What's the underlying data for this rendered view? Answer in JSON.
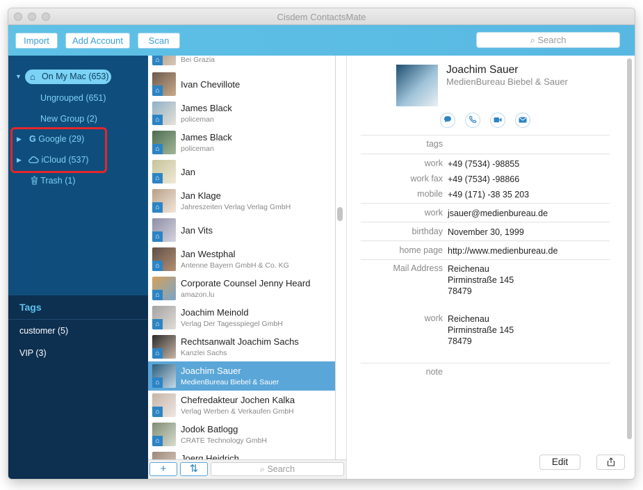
{
  "window": {
    "title": "Cisdem ContactsMate"
  },
  "toolbar": {
    "import_label": "Import",
    "add_account_label": "Add Account",
    "scan_label": "Scan",
    "search_placeholder": "Search"
  },
  "sidebar": {
    "on_my_mac": "On My Mac (653)",
    "ungrouped": "Ungrouped (651)",
    "new_group": "New Group (2)",
    "google": "Google (29)",
    "icloud": "iCloud (537)",
    "trash": "Trash (1)",
    "tags_title": "Tags",
    "tags": [
      "customer (5)",
      "VIP (3)"
    ]
  },
  "contacts": [
    {
      "name": "",
      "subtitle": "Bei Grazia",
      "selected": false
    },
    {
      "name": "Ivan Chevillote",
      "subtitle": "",
      "selected": false
    },
    {
      "name": "James Black",
      "subtitle": "policeman",
      "selected": false
    },
    {
      "name": "James Black",
      "subtitle": "policeman",
      "selected": false
    },
    {
      "name": "Jan",
      "subtitle": "",
      "selected": false
    },
    {
      "name": "Jan Klage",
      "subtitle": "Jahreszeiten Verlag Verlag GmbH",
      "selected": false
    },
    {
      "name": "Jan Vits",
      "subtitle": "",
      "selected": false
    },
    {
      "name": "Jan Westphal",
      "subtitle": "Antenne Bayern GmbH & Co. KG",
      "selected": false
    },
    {
      "name": "Corporate Counsel Jenny Heard",
      "subtitle": "amazon.lu",
      "selected": false
    },
    {
      "name": "Joachim Meinold",
      "subtitle": "Verlag Der Tagesspiegel GmbH",
      "selected": false
    },
    {
      "name": "Rechtsanwalt Joachim Sachs",
      "subtitle": "Kanzlei Sachs",
      "selected": false
    },
    {
      "name": "Joachim Sauer",
      "subtitle": "MedienBureau Biebel & Sauer",
      "selected": true
    },
    {
      "name": "Chefredakteur Jochen Kalka",
      "subtitle": "Verlag Werben & Verkaufen GmbH",
      "selected": false
    },
    {
      "name": "Jodok Batlogg",
      "subtitle": "CRATE Technology GmbH",
      "selected": false
    },
    {
      "name": "Joerg Heidrich",
      "subtitle": "",
      "selected": false
    }
  ],
  "list_footer": {
    "add_label": "+",
    "sort_label": "⇅",
    "search_placeholder": "Search"
  },
  "detail": {
    "name": "Joachim Sauer",
    "company": "MedienBureau Biebel & Sauer",
    "actions": [
      "message-icon",
      "phone-icon",
      "video-icon",
      "mail-icon"
    ],
    "tags_label": "tags",
    "phones": [
      {
        "label": "work",
        "value": "+49 (7534) -98855"
      },
      {
        "label": "work fax",
        "value": "+49 (7534) -98866"
      },
      {
        "label": "mobile",
        "value": "+49 (171) -38 35 203"
      }
    ],
    "email": {
      "label": "work",
      "value": "jsauer@medienbureau.de"
    },
    "birthday": {
      "label": "birthday",
      "value": "November 30, 1999"
    },
    "homepage": {
      "label": "home page",
      "value": "http://www.medienbureau.de"
    },
    "addresses": [
      {
        "label": "Mail Address",
        "line1": "Reichenau",
        "line2": "Pirminstraße 145",
        "line3": "78479"
      },
      {
        "label": "work",
        "line1": "Reichenau",
        "line2": "Pirminstraße 145",
        "line3": "78479"
      }
    ],
    "note_label": "note",
    "edit_label": "Edit",
    "share_icon": "share-icon"
  },
  "colors": {
    "toolbar": "#5fc1e6",
    "sidebar": "#0f4e7c",
    "sidebar_tags": "#0d2f50",
    "selection": "#5ba6d8",
    "highlight": "#e5262b"
  }
}
